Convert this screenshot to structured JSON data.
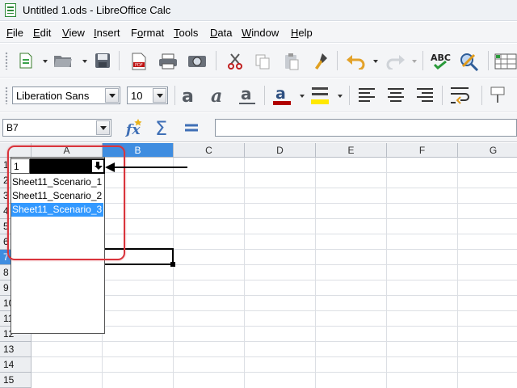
{
  "window": {
    "title": "Untitled 1.ods - LibreOffice Calc",
    "icon": "calc-document-icon"
  },
  "menubar": {
    "items": [
      {
        "label": "File",
        "accel": "F",
        "rest": "ile"
      },
      {
        "label": "Edit",
        "accel": "E",
        "rest": "dit"
      },
      {
        "label": "View",
        "accel": "V",
        "rest": "iew"
      },
      {
        "label": "Insert",
        "accel": "I",
        "rest": "nsert"
      },
      {
        "label": "Format",
        "accel": "o",
        "pre": "F",
        "rest": "rmat"
      },
      {
        "label": "Tools",
        "accel": "T",
        "rest": "ools"
      },
      {
        "label": "Data",
        "accel": "D",
        "rest": "ata"
      },
      {
        "label": "Window",
        "accel": "W",
        "rest": "indow"
      },
      {
        "label": "Help",
        "accel": "H",
        "rest": "elp"
      }
    ]
  },
  "toolbar_standard": {
    "icons": [
      "new-document-icon",
      "open-folder-icon",
      "save-icon",
      "export-pdf-icon",
      "print-icon",
      "print-preview-icon",
      "cut-icon",
      "copy-icon",
      "paste-icon",
      "clone-formatting-icon",
      "undo-icon",
      "redo-icon",
      "spellcheck-icon",
      "autospellcheck-icon",
      "grid-icon"
    ]
  },
  "toolbar_formatting": {
    "font_name": "Liberation Sans",
    "font_size": "10",
    "icons": [
      "bold-icon",
      "italic-icon",
      "underline-icon",
      "font-color-icon",
      "highlight-color-icon",
      "align-left-icon",
      "align-center-icon",
      "align-right-icon",
      "wrap-text-icon",
      "merge-icon"
    ],
    "colors": {
      "font_color": "#b00000",
      "highlight_color": "#ffe800"
    }
  },
  "formula_bar": {
    "name_box": "B7",
    "formula_value": "",
    "icons": [
      "function-wizard-icon",
      "sum-icon",
      "formula-equals-icon"
    ]
  },
  "sheet": {
    "columns": [
      "A",
      "B",
      "C",
      "D",
      "E",
      "F",
      "G"
    ],
    "active_column": "B",
    "rows": [
      "1",
      "2",
      "3",
      "4",
      "5",
      "6",
      "7",
      "8",
      "9",
      "10",
      "11",
      "12",
      "13",
      "14",
      "15"
    ],
    "active_row": "7",
    "active_cell": "B7"
  },
  "scenario_selector": {
    "row_label": "1",
    "options": [
      "Sheet11_Scenario_1",
      "Sheet11_Scenario_2",
      "Sheet11_Scenario_3"
    ],
    "selected_index": 2,
    "highlight_color": "#3399ff"
  },
  "annotation": {
    "ring_color": "#d9343c",
    "arrow_color": "#000000"
  }
}
